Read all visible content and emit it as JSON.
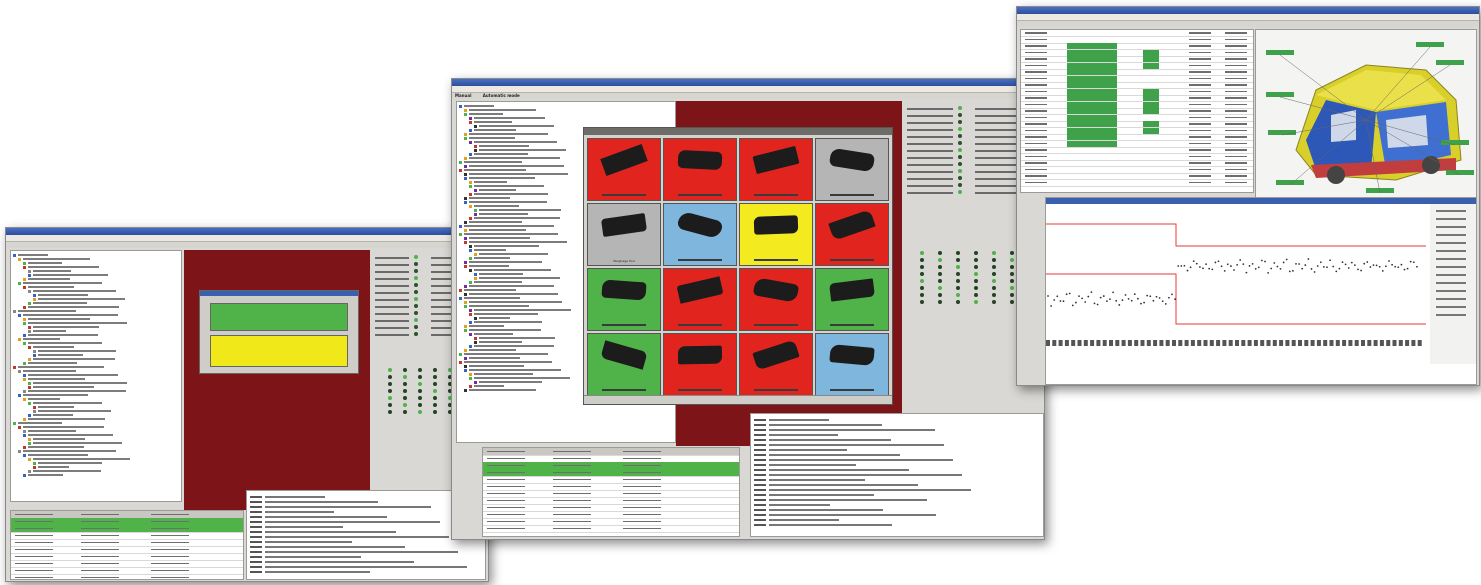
{
  "window_left": {
    "title": "",
    "dialog_buttons": [
      "",
      ""
    ],
    "button_colors": [
      "#4fb34a",
      "#f1e81a"
    ]
  },
  "window_center": {
    "title": "",
    "subbar": [
      "Manual",
      "Automatic mode"
    ],
    "tile_colors": [
      "#e2241f",
      "#e2241f",
      "#e2241f",
      "#b5b5b5",
      "#b5b5b5",
      "#7fb6dd",
      "#f3ea1f",
      "#e2241f",
      "#4fb34a",
      "#e2241f",
      "#e2241f",
      "#4fb34a",
      "#4fb34a",
      "#e2241f",
      "#e2241f",
      "#7fb6dd"
    ],
    "tile_caption": "Weighage Tool"
  },
  "window_right": {
    "title": "",
    "chart_colors": {
      "line": "#e63a3a",
      "points": "#333333",
      "green": "#3fa14a"
    }
  }
}
